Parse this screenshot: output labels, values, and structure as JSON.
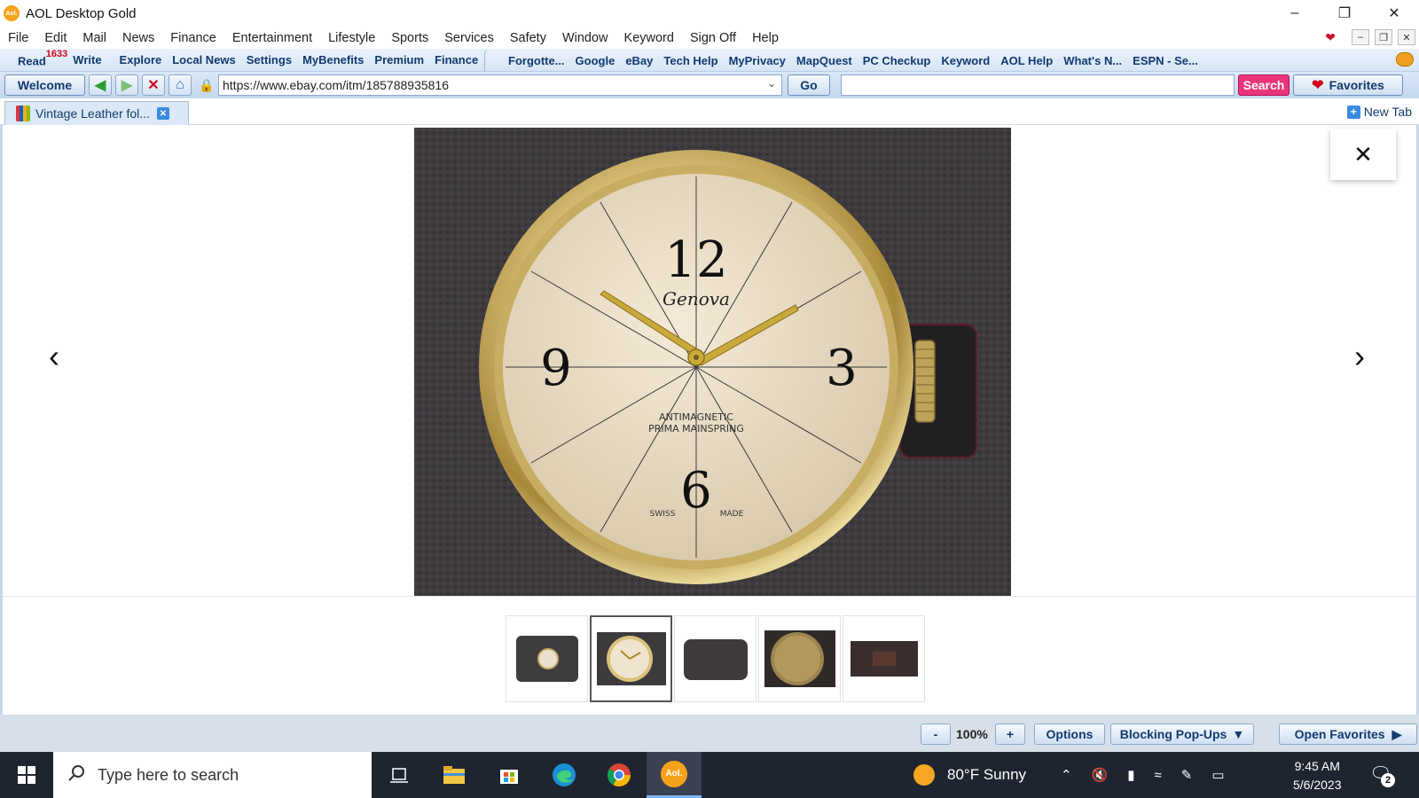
{
  "window": {
    "app_logo_text": "Aol.",
    "title": "AOL Desktop Gold",
    "min_icon": "–",
    "restore_icon": "❐",
    "close_icon": "✕"
  },
  "menu": {
    "items": [
      "File",
      "Edit",
      "Mail",
      "News",
      "Finance",
      "Entertainment",
      "Lifestyle",
      "Sports",
      "Services",
      "Safety",
      "Window",
      "Keyword",
      "Sign Off",
      "Help"
    ]
  },
  "linkbar": {
    "read": "Read",
    "read_count": "1633",
    "write": "Write",
    "group1": [
      "Explore",
      "Local News",
      "Settings",
      "MyBenefits",
      "Premium",
      "Finance"
    ],
    "group2": [
      "Forgotte...",
      "Google",
      "eBay",
      "Tech Help",
      "MyPrivacy",
      "MapQuest",
      "PC Checkup",
      "Keyword",
      "AOL Help",
      "What's N...",
      "ESPN - Se..."
    ]
  },
  "navbar": {
    "welcome": "Welcome",
    "url": "https://www.ebay.com/itm/185788935816",
    "go": "Go",
    "search_value": "",
    "search": "Search",
    "favorites": "Favorites"
  },
  "tabs": {
    "active_title": "Vintage Leather fol...",
    "new_tab": "New Tab"
  },
  "viewer": {
    "close": "✕",
    "prev": "‹",
    "next": "›",
    "thumb_count": 5,
    "selected_thumb": 2,
    "watch_dial": {
      "brand": "Genova",
      "line1": "ANTIMAGNETIC",
      "line2": "PRIMA MAINSPRING",
      "swiss": "SWISS",
      "made": "MADE",
      "n12": "12",
      "n3": "3",
      "n6": "6",
      "n9": "9"
    }
  },
  "statusbar": {
    "zoom_minus": "-",
    "zoom": "100%",
    "zoom_plus": "+",
    "options": "Options",
    "popups": "Blocking Pop-Ups",
    "open_favorites": "Open Favorites"
  },
  "taskbar": {
    "search_placeholder": "Type here to search",
    "aol_label": "Aol.",
    "weather": "80°F  Sunny",
    "time": "9:45 AM",
    "date": "5/6/2023",
    "notifications": "2"
  },
  "colors": {
    "aol_orange": "#f7a21b",
    "search_pink": "#e8347a",
    "link_blue": "#123a6e"
  }
}
